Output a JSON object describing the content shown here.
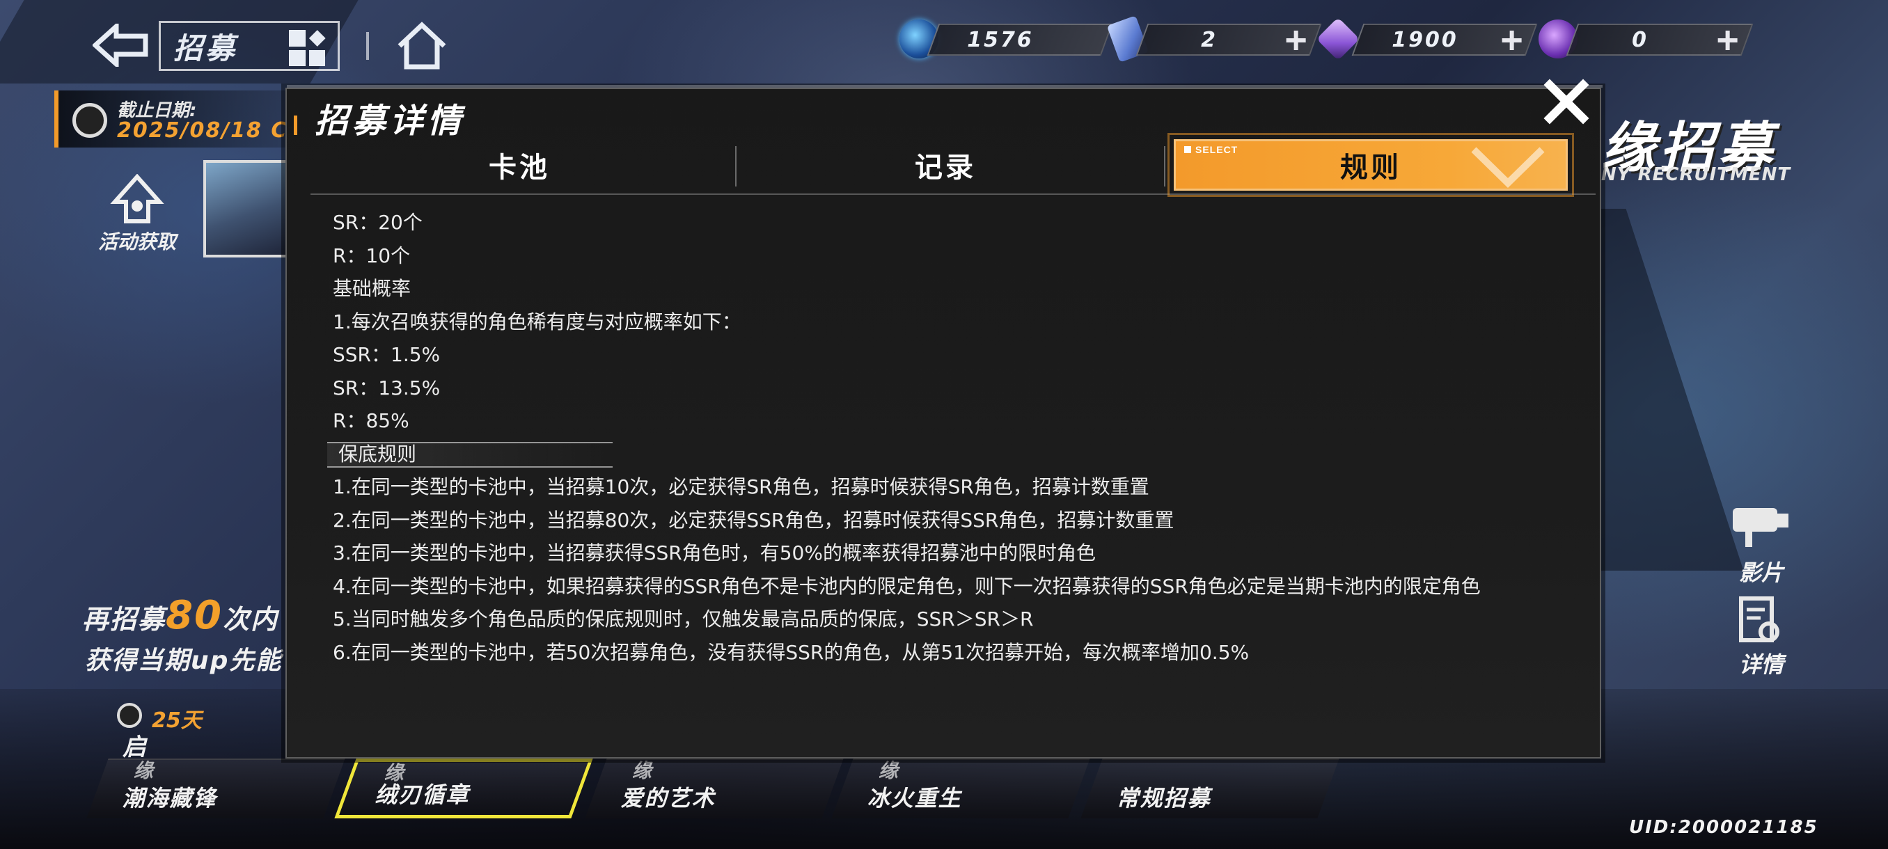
{
  "topbar": {
    "page_title": "招募",
    "currencies": [
      {
        "icon": "crystal-orb-icon",
        "value": "1576"
      },
      {
        "icon": "ticket-card-icon",
        "value": "2"
      },
      {
        "icon": "prism-gem-icon",
        "value": "1900"
      },
      {
        "icon": "purple-orb-icon",
        "value": "0"
      }
    ]
  },
  "left": {
    "deadline_label": "截止日期:",
    "deadline_date": "2025/08/18",
    "deadline_date_suffix": "C",
    "activity_label": "活动获取",
    "promo_prefix": "再招募",
    "promo_count": "80",
    "promo_suffix": "次内",
    "promo_line2": "获得当期up先能"
  },
  "banner": {
    "title": "缘招募",
    "subtitle": "NY RECRUITMENT"
  },
  "side_buttons": {
    "video_label": "影片",
    "detail_label": "详情"
  },
  "pools": {
    "days_left": "25天",
    "first_tag": "启",
    "items": [
      {
        "tag": "缘",
        "name": "潮海藏锋"
      },
      {
        "tag": "缘",
        "name": "绒刃循章"
      },
      {
        "tag": "缘",
        "name": "爱的艺术"
      },
      {
        "tag": "缘",
        "name": "冰火重生"
      },
      {
        "tag": "",
        "name": "常规招募"
      }
    ]
  },
  "uid": "UID:2000021185",
  "modal": {
    "title": "招募详情",
    "tabs": [
      "卡池",
      "记录",
      "规则"
    ],
    "selected_tag": "SELECT",
    "rules": [
      "SR：20个",
      "R：10个",
      "基础概率",
      "1.每次召唤获得的角色稀有度与对应概率如下：",
      "SSR：1.5%",
      "SR：13.5%",
      "R：85%"
    ],
    "guarantee_heading": "保底规则",
    "guarantee_rules": [
      "1.在同一类型的卡池中，当招募10次，必定获得SR角色，招募时候获得SR角色，招募计数重置",
      "2.在同一类型的卡池中，当招募80次，必定获得SSR角色，招募时候获得SSR角色，招募计数重置",
      "3.在同一类型的卡池中，当招募获得SSR角色时，有50%的概率获得招募池中的限时角色",
      "4.在同一类型的卡池中，如果招募获得的SSR角色不是卡池内的限定角色，则下一次招募获得的SSR角色必定是当期卡池内的限定角色",
      "5.当同时触发多个角色品质的保底规则时，仅触发最高品质的保底，SSR＞SR＞R",
      "6.在同一类型的卡池中，若50次招募角色，没有获得SSR的角色，从第51次招募开始，每次概率增加0.5%"
    ]
  },
  "colors": {
    "accent_orange": "#f39b2a",
    "active_pool_border": "#f0e63a",
    "modal_bg": "#1b1b1b"
  }
}
